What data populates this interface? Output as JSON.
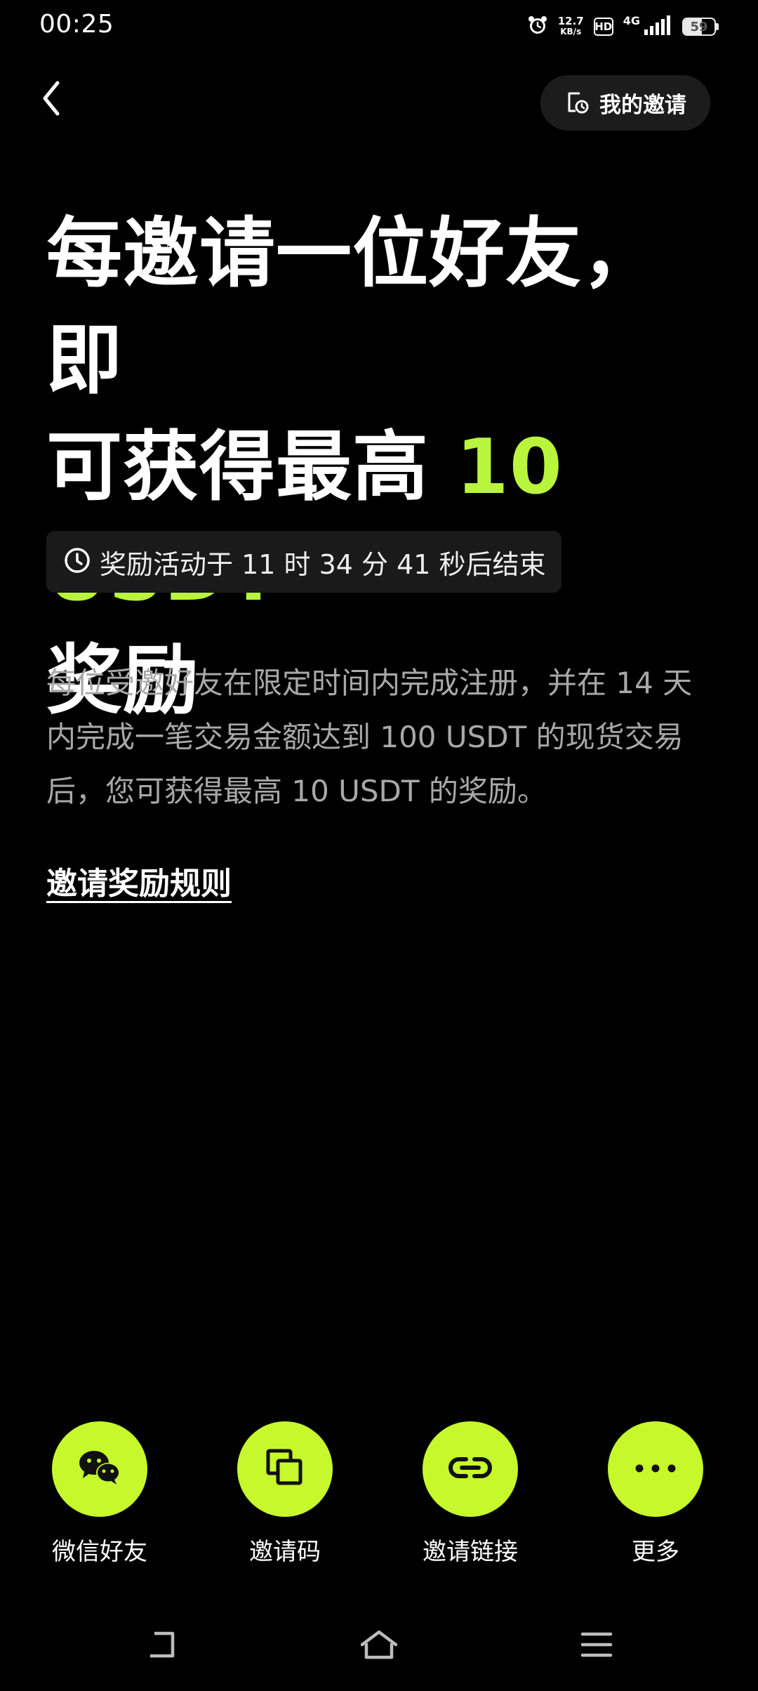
{
  "status_bar": {
    "time": "00:25",
    "net_speed_value": "12.7",
    "net_speed_unit": "KB/s",
    "hd_label": "HD",
    "network_type": "4G",
    "battery_level": "59"
  },
  "header": {
    "my_invites_label": "我的邀请"
  },
  "headline": {
    "line1": "每邀请一位好友，即",
    "line2_prefix": "可获得最高 ",
    "amount": "10 USDT",
    "line3": "奖励"
  },
  "countdown": {
    "text": "奖励活动于 11 时 34 分 41 秒后结束"
  },
  "description": "每位受邀好友在限定时间内完成注册，并在 14 天内完成一笔交易金额达到 100 USDT 的现货交易后，您可获得最高 10 USDT 的奖励。",
  "rules_link": "邀请奖励规则",
  "share_options": [
    {
      "label": "微信好友",
      "icon": "wechat-icon"
    },
    {
      "label": "邀请码",
      "icon": "copy-icon"
    },
    {
      "label": "邀请链接",
      "icon": "link-icon"
    },
    {
      "label": "更多",
      "icon": "more-icon"
    }
  ],
  "colors": {
    "background": "#000000",
    "accent": "#b8f53c",
    "button_fill": "#c6f82c",
    "muted_text": "#a8a8a8",
    "chip_bg": "#1a1a1a"
  }
}
